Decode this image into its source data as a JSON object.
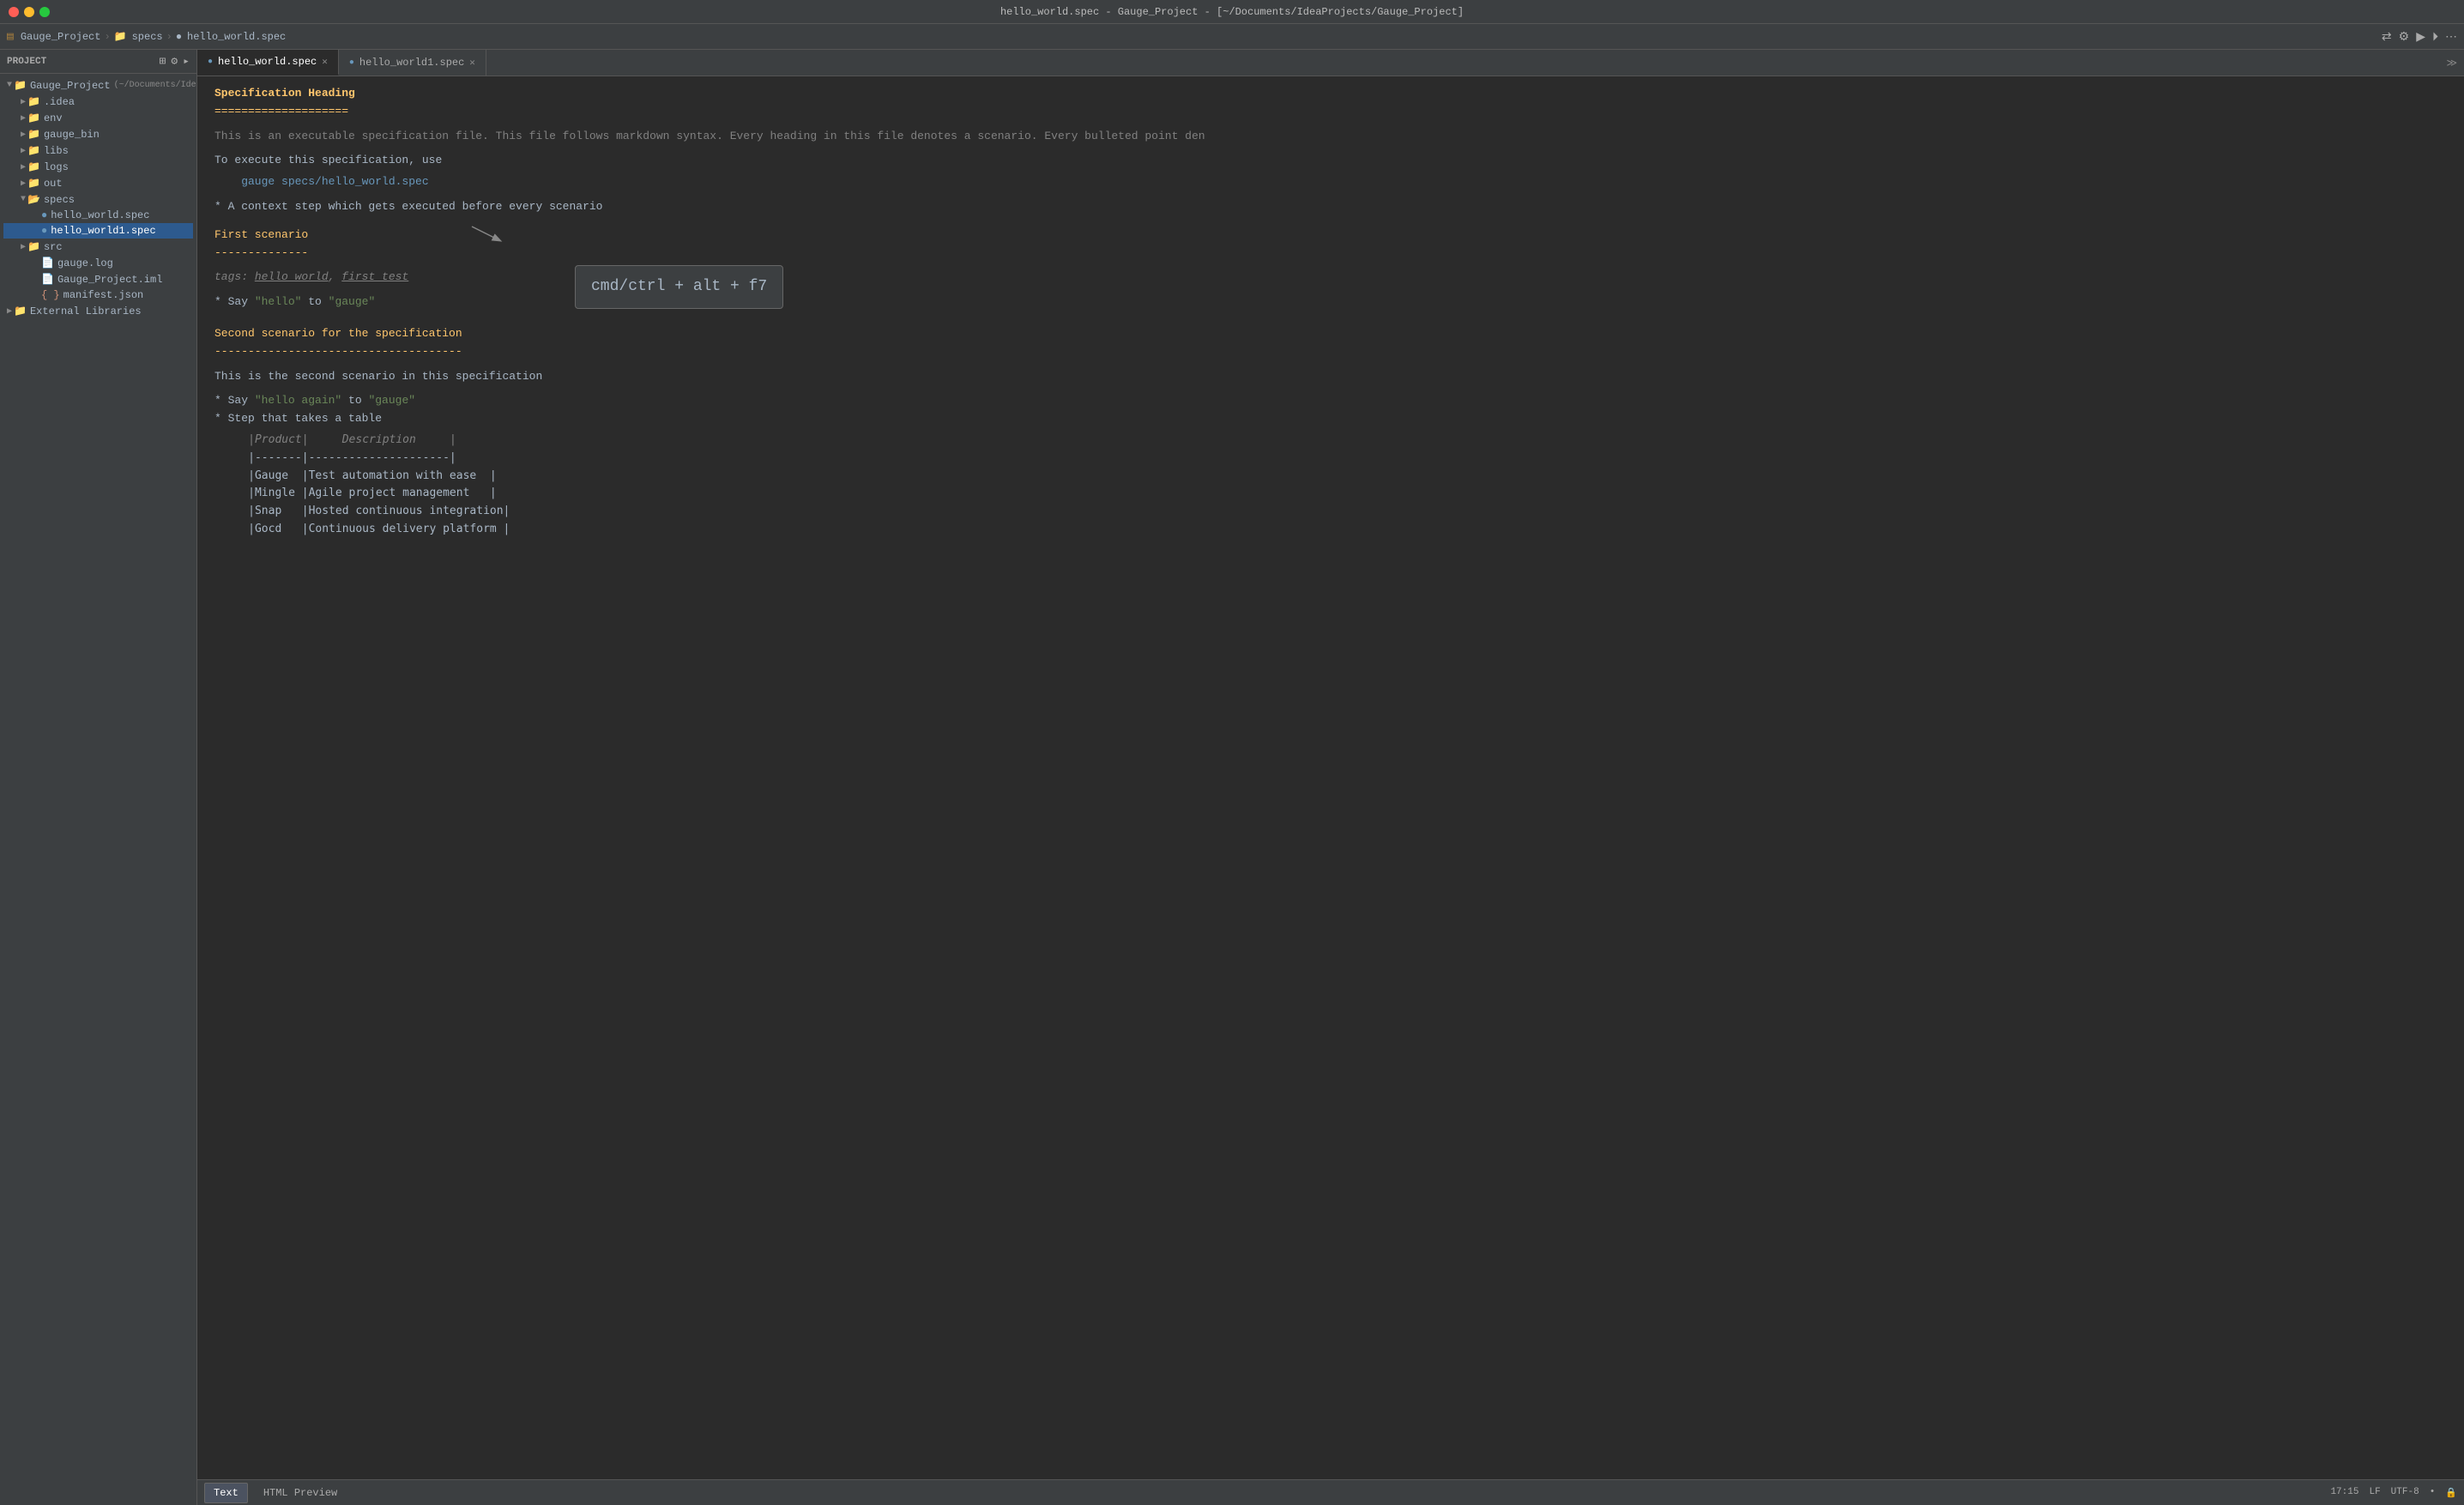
{
  "window": {
    "title": "hello_world.spec - Gauge_Project - [~/Documents/IdeaProjects/Gauge_Project]"
  },
  "titlebar": {
    "title": "hello_world.spec - Gauge_Project - [~/Documents/IdeaProjects/Gauge_Project]"
  },
  "navbar": {
    "project": "Gauge_Project",
    "breadcrumb": [
      "Gauge_Project",
      "specs",
      "hello_world.spec"
    ]
  },
  "sidebar": {
    "header": "Project",
    "project_label": "Gauge_Project",
    "project_path": "(~/Documents/IdeaProjects/Gauge_Proj...",
    "items": [
      {
        "id": "idea",
        "label": ".idea",
        "indent": 1,
        "type": "folder",
        "expanded": false
      },
      {
        "id": "env",
        "label": "env",
        "indent": 1,
        "type": "folder",
        "expanded": false
      },
      {
        "id": "gauge_bin",
        "label": "gauge_bin",
        "indent": 1,
        "type": "folder",
        "expanded": false
      },
      {
        "id": "libs",
        "label": "libs",
        "indent": 1,
        "type": "folder",
        "expanded": false
      },
      {
        "id": "logs",
        "label": "logs",
        "indent": 1,
        "type": "folder",
        "expanded": false
      },
      {
        "id": "out",
        "label": "out",
        "indent": 1,
        "type": "folder",
        "expanded": false
      },
      {
        "id": "specs",
        "label": "specs",
        "indent": 1,
        "type": "folder",
        "expanded": true
      },
      {
        "id": "hello_world_spec",
        "label": "hello_world.spec",
        "indent": 2,
        "type": "spec",
        "expanded": false
      },
      {
        "id": "hello_world1_spec",
        "label": "hello_world1.spec",
        "indent": 2,
        "type": "spec",
        "expanded": false,
        "selected": true
      },
      {
        "id": "src",
        "label": "src",
        "indent": 1,
        "type": "folder",
        "expanded": false
      },
      {
        "id": "gauge_log",
        "label": "gauge.log",
        "indent": 2,
        "type": "log"
      },
      {
        "id": "gauge_project_iml",
        "label": "Gauge_Project.iml",
        "indent": 2,
        "type": "iml"
      },
      {
        "id": "manifest_json",
        "label": "manifest.json",
        "indent": 2,
        "type": "json"
      },
      {
        "id": "external_libraries",
        "label": "External Libraries",
        "indent": 0,
        "type": "folder",
        "expanded": false
      }
    ]
  },
  "tabs": [
    {
      "id": "hello_world_spec",
      "label": "hello_world.spec",
      "active": true,
      "icon": "spec"
    },
    {
      "id": "hello_world1_spec",
      "label": "hello_world1.spec",
      "active": false,
      "icon": "spec"
    }
  ],
  "editor": {
    "heading": "Specification Heading",
    "heading_underline": "====================",
    "description_line1": "This is an executable specification file. This file follows markdown syntax. Every heading in this file denotes a scenario. Every bulleted point den",
    "blank1": "",
    "execute_line": "To execute this specification, use",
    "blank2": "",
    "command": "    gauge specs/hello_world.spec",
    "blank3": "",
    "context_step": "* A context step which gets executed before every scenario",
    "blank4": "",
    "scenario1_title": "First scenario",
    "scenario1_underline": "--------------",
    "blank5": "",
    "tags_line": "tags: hello world, first_test",
    "blank6": "",
    "step1": "* Say \"hello\" to \"gauge\"",
    "blank7": "",
    "scenario2_title": "Second scenario for the specification",
    "scenario2_underline": "-------------------------------------",
    "blank8": "",
    "scenario2_desc": "This is the second scenario in this specification",
    "blank9": "",
    "step2": "* Say \"hello again\" to \"gauge\"",
    "step3": "* Step that takes a table",
    "table_header": "     |Product|     Description     |",
    "table_sep1": "     |-------|---------------------|",
    "table_row1": "     |Gauge  |Test automation with ease  |",
    "table_row2": "     |Mingle |Agile project management   |",
    "table_row3": "     |Snap   |Hosted continuous integration|",
    "table_row4": "     |Gocd   |Continuous delivery platform |"
  },
  "shortcut_popup": {
    "text": "cmd/ctrl + alt + f7"
  },
  "bottom_tabs": [
    {
      "id": "text",
      "label": "Text",
      "active": true
    },
    {
      "id": "html_preview",
      "label": "HTML Preview",
      "active": false
    }
  ],
  "status_bar": {
    "position": "17:15",
    "lf": "LF",
    "encoding": "UTF-8",
    "separator": "•"
  }
}
